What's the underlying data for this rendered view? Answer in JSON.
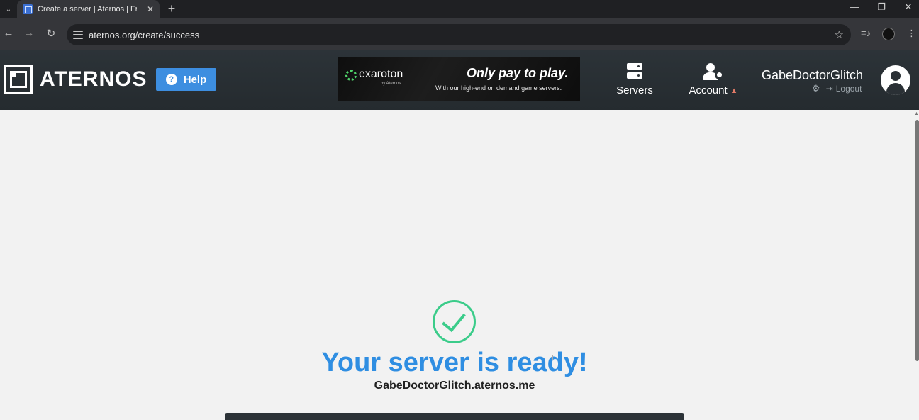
{
  "browser": {
    "tab": {
      "title": "Create a server | Aternos | Free"
    },
    "url": "aternos.org/create/success"
  },
  "header": {
    "logo": "ATERNOS",
    "help_label": "Help",
    "ad": {
      "brand": "exaroton",
      "brand_sub": "by Aternos",
      "headline": "Only pay to play.",
      "subline": "With our high-end on demand game servers."
    },
    "nav": {
      "servers_label": "Servers",
      "account_label": "Account"
    },
    "user": {
      "name": "GabeDoctorGlitch",
      "logout_label": "Logout"
    }
  },
  "main": {
    "title": "Your server is ready!",
    "address": "GabeDoctorGlitch.aternos.me"
  },
  "colors": {
    "accent_blue": "#2f8ee2",
    "success_green": "#3bcc8a",
    "header_bg": "#2a3035",
    "warning": "#e07a67"
  }
}
